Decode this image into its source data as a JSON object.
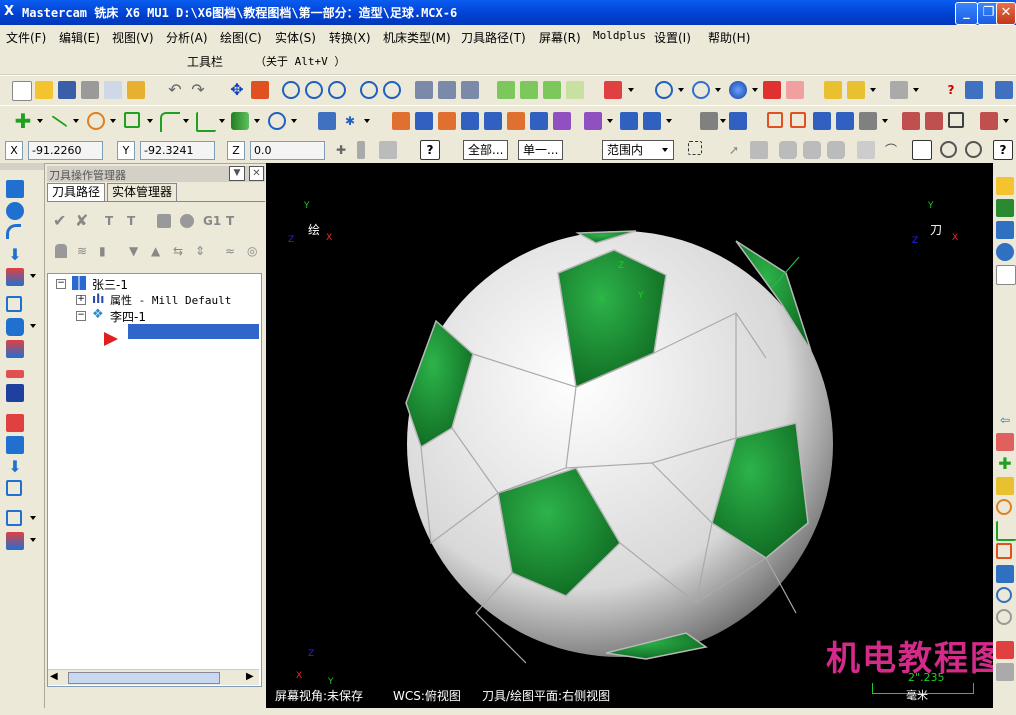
{
  "window": {
    "title": "Mastercam 铣床 X6 MU1  D:\\X6图档\\教程图档\\第一部分：造型\\足球.MCX-6",
    "min_icon": "minimize-icon",
    "max_icon": "restore-icon",
    "close_icon": "close-icon"
  },
  "menu": [
    "文件(F)",
    "编辑(E)",
    "视图(V)",
    "分析(A)",
    "绘图(C)",
    "实体(S)",
    "转换(X)",
    "机床类型(M)",
    "刀具路径(T)",
    "屏幕(R)",
    "Moldplus",
    "设置(I)",
    "帮助(H)"
  ],
  "toolbar_label": {
    "name": "工具栏",
    "hint": "（关于 Alt+V ）"
  },
  "coords": {
    "x_label": "X",
    "x_value": "-91.2260",
    "y_label": "Y",
    "y_value": "-92.3241",
    "z_label": "Z",
    "z_value": "0.0"
  },
  "selection": {
    "all_label": "全部...",
    "single_label": "单一...",
    "range_value": "范围内"
  },
  "manager": {
    "title": "刀具操作管理器",
    "tabs": [
      "刀具路径",
      "实体管理器"
    ],
    "tree": {
      "machine": "张三-1",
      "properties": "属性 - Mill Default",
      "group": "李四-1"
    }
  },
  "viewport": {
    "top_left_label": "绘",
    "top_right_label": "刀",
    "axis_x": "X",
    "axis_y": "Y",
    "axis_z": "Z",
    "status_view": "屏幕视角:未保存",
    "status_wcs": "WCS:俯视图",
    "status_plane": "刀具/绘图平面:右侧视图",
    "scale_value": "2\".235",
    "scale_unit": "毫米",
    "watermark": "机电教程图"
  },
  "colors": {
    "titlebar": "#0a5cf0",
    "panel_green": "#1b9632",
    "ball_white": "#f2f2f2",
    "highlight": "#3166c8",
    "watermark": "#d42a8a"
  }
}
